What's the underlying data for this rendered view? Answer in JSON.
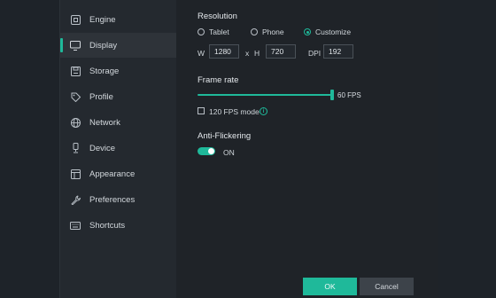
{
  "sidebar": {
    "items": [
      {
        "label": "Engine",
        "icon": "engine-icon"
      },
      {
        "label": "Display",
        "icon": "display-icon",
        "active": true
      },
      {
        "label": "Storage",
        "icon": "storage-icon"
      },
      {
        "label": "Profile",
        "icon": "profile-icon"
      },
      {
        "label": "Network",
        "icon": "globe-icon"
      },
      {
        "label": "Device",
        "icon": "device-icon"
      },
      {
        "label": "Appearance",
        "icon": "appearance-icon"
      },
      {
        "label": "Preferences",
        "icon": "wrench-icon"
      },
      {
        "label": "Shortcuts",
        "icon": "keyboard-icon"
      }
    ]
  },
  "resolution": {
    "title": "Resolution",
    "options": [
      "Tablet",
      "Phone",
      "Customize"
    ],
    "selected": "Customize",
    "w_label": "W",
    "w_value": "1280",
    "x_label": "x",
    "h_label": "H",
    "h_value": "720",
    "dpi_label": "DPI",
    "dpi_value": "192"
  },
  "frame_rate": {
    "title": "Frame rate",
    "value_label": "60 FPS",
    "checkbox_label": "120 FPS mode",
    "checkbox_checked": false
  },
  "anti_flicker": {
    "title": "Anti-Flickering",
    "state_label": "ON",
    "enabled": true
  },
  "buttons": {
    "ok": "OK",
    "cancel": "Cancel"
  },
  "colors": {
    "accent": "#1fb99a",
    "background": "#1f2328",
    "sidebar": "#24292f"
  }
}
